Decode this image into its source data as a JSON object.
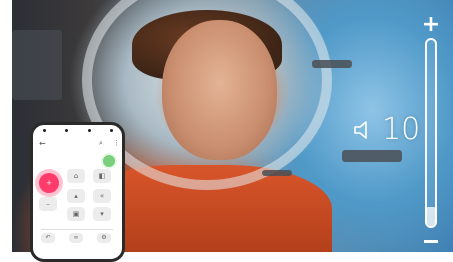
{
  "volume": {
    "value_label": "10",
    "level": 0.1,
    "increase_label": "+",
    "decrease_label": "−"
  },
  "phone_remote": {
    "back_icon": "arrow-left-icon",
    "search_icon": "search-icon",
    "more_icon": "more-vertical-icon",
    "accent_color": "#ff3b6b"
  },
  "colors": {
    "slider": "#ffffff",
    "suit": "#d9552a"
  }
}
